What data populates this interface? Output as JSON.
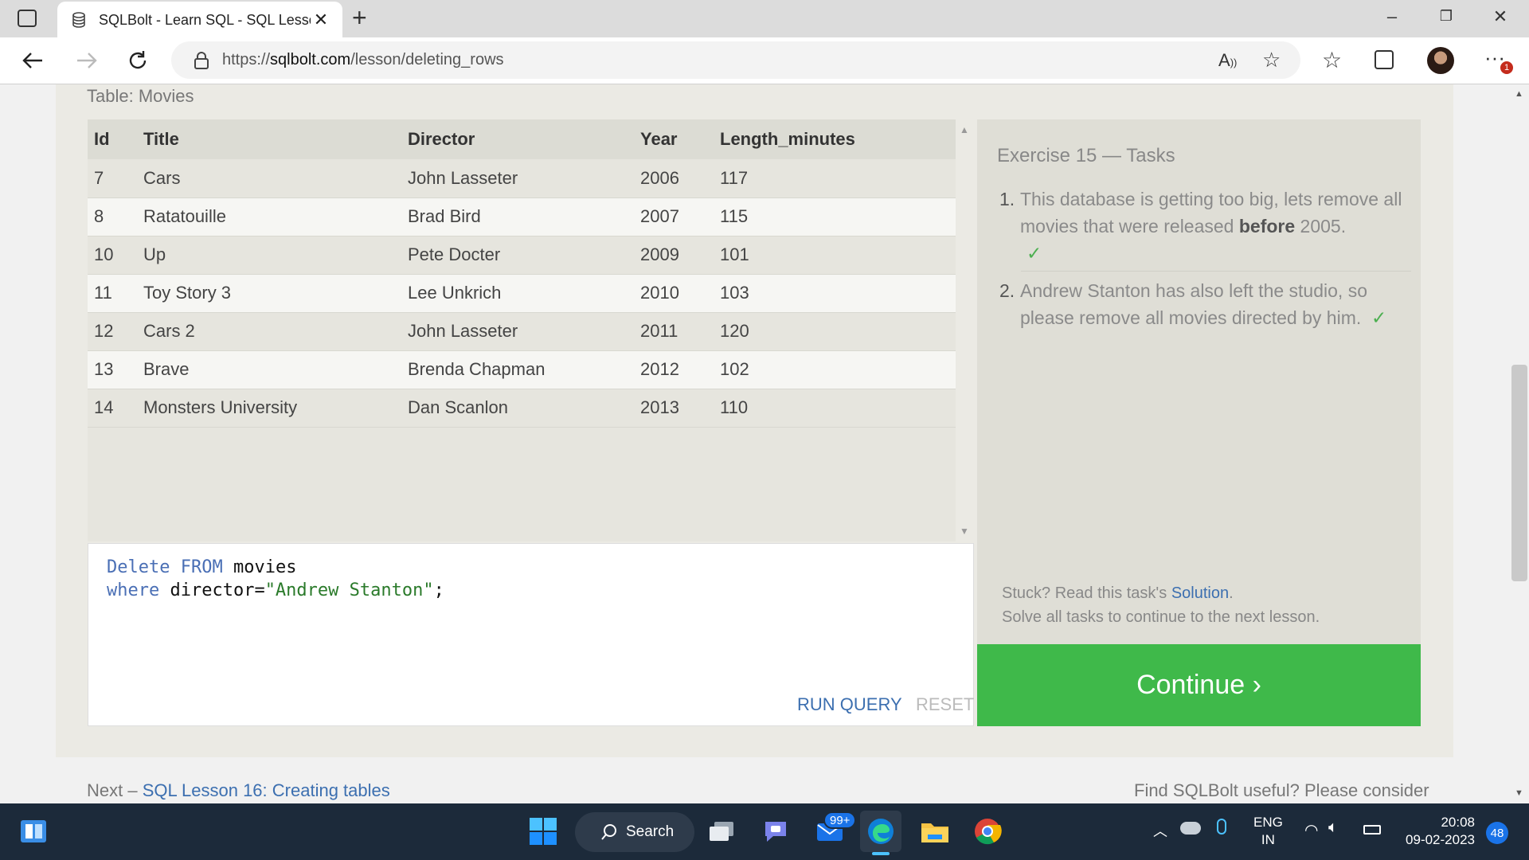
{
  "browser": {
    "tab_title": "SQLBolt - Learn SQL - SQL Lesso",
    "url_prefix": "https://",
    "url_domain": "sqlbolt.com",
    "url_path": "/lesson/deleting_rows",
    "notification_badge": "1"
  },
  "lesson": {
    "table_label": "Table: Movies",
    "columns": [
      "Id",
      "Title",
      "Director",
      "Year",
      "Length_minutes"
    ],
    "rows": [
      [
        "7",
        "Cars",
        "John Lasseter",
        "2006",
        "117"
      ],
      [
        "8",
        "Ratatouille",
        "Brad Bird",
        "2007",
        "115"
      ],
      [
        "10",
        "Up",
        "Pete Docter",
        "2009",
        "101"
      ],
      [
        "11",
        "Toy Story 3",
        "Lee Unkrich",
        "2010",
        "103"
      ],
      [
        "12",
        "Cars 2",
        "John Lasseter",
        "2011",
        "120"
      ],
      [
        "13",
        "Brave",
        "Brenda Chapman",
        "2012",
        "102"
      ],
      [
        "14",
        "Monsters University",
        "Dan Scanlon",
        "2013",
        "110"
      ]
    ],
    "code": {
      "line1_kw1": "Delete",
      "line1_kw2": "FROM",
      "line1_rest": " movies",
      "line2_kw": "where",
      "line2_rest": " director=",
      "line2_str": "\"Andrew Stanton\"",
      "line2_end": ";"
    },
    "run_query": "RUN QUERY",
    "reset": "RESET",
    "tasks_title": "Exercise 15 — Tasks",
    "task1_num": "1.",
    "task1_pre": "This database is getting too big, lets remove all movies that were released ",
    "task1_bold": "before",
    "task1_post": " 2005.",
    "task2_num": "2.",
    "task2_text": "Andrew Stanton has also left the studio, so please remove all movies directed by him.",
    "checkmark": "✓",
    "stuck_pre": "Stuck? Read this task's ",
    "stuck_link": "Solution",
    "stuck_post": ".",
    "solve_all": "Solve all tasks to continue to the next lesson.",
    "continue": "Continue ›",
    "next_pre": "Next – ",
    "next_link": "SQL Lesson 16: Creating tables",
    "find_useful": "Find SQLBolt useful? Please consider"
  },
  "taskbar": {
    "search": "Search",
    "mail_badge": "99+",
    "lang1": "ENG",
    "lang2": "IN",
    "time": "20:08",
    "date": "09-02-2023",
    "notif_count": "48"
  },
  "colors": {
    "continue_green": "#3fb94a",
    "link_blue": "#3c6fb0",
    "taskbar": "#1c2a3a"
  }
}
